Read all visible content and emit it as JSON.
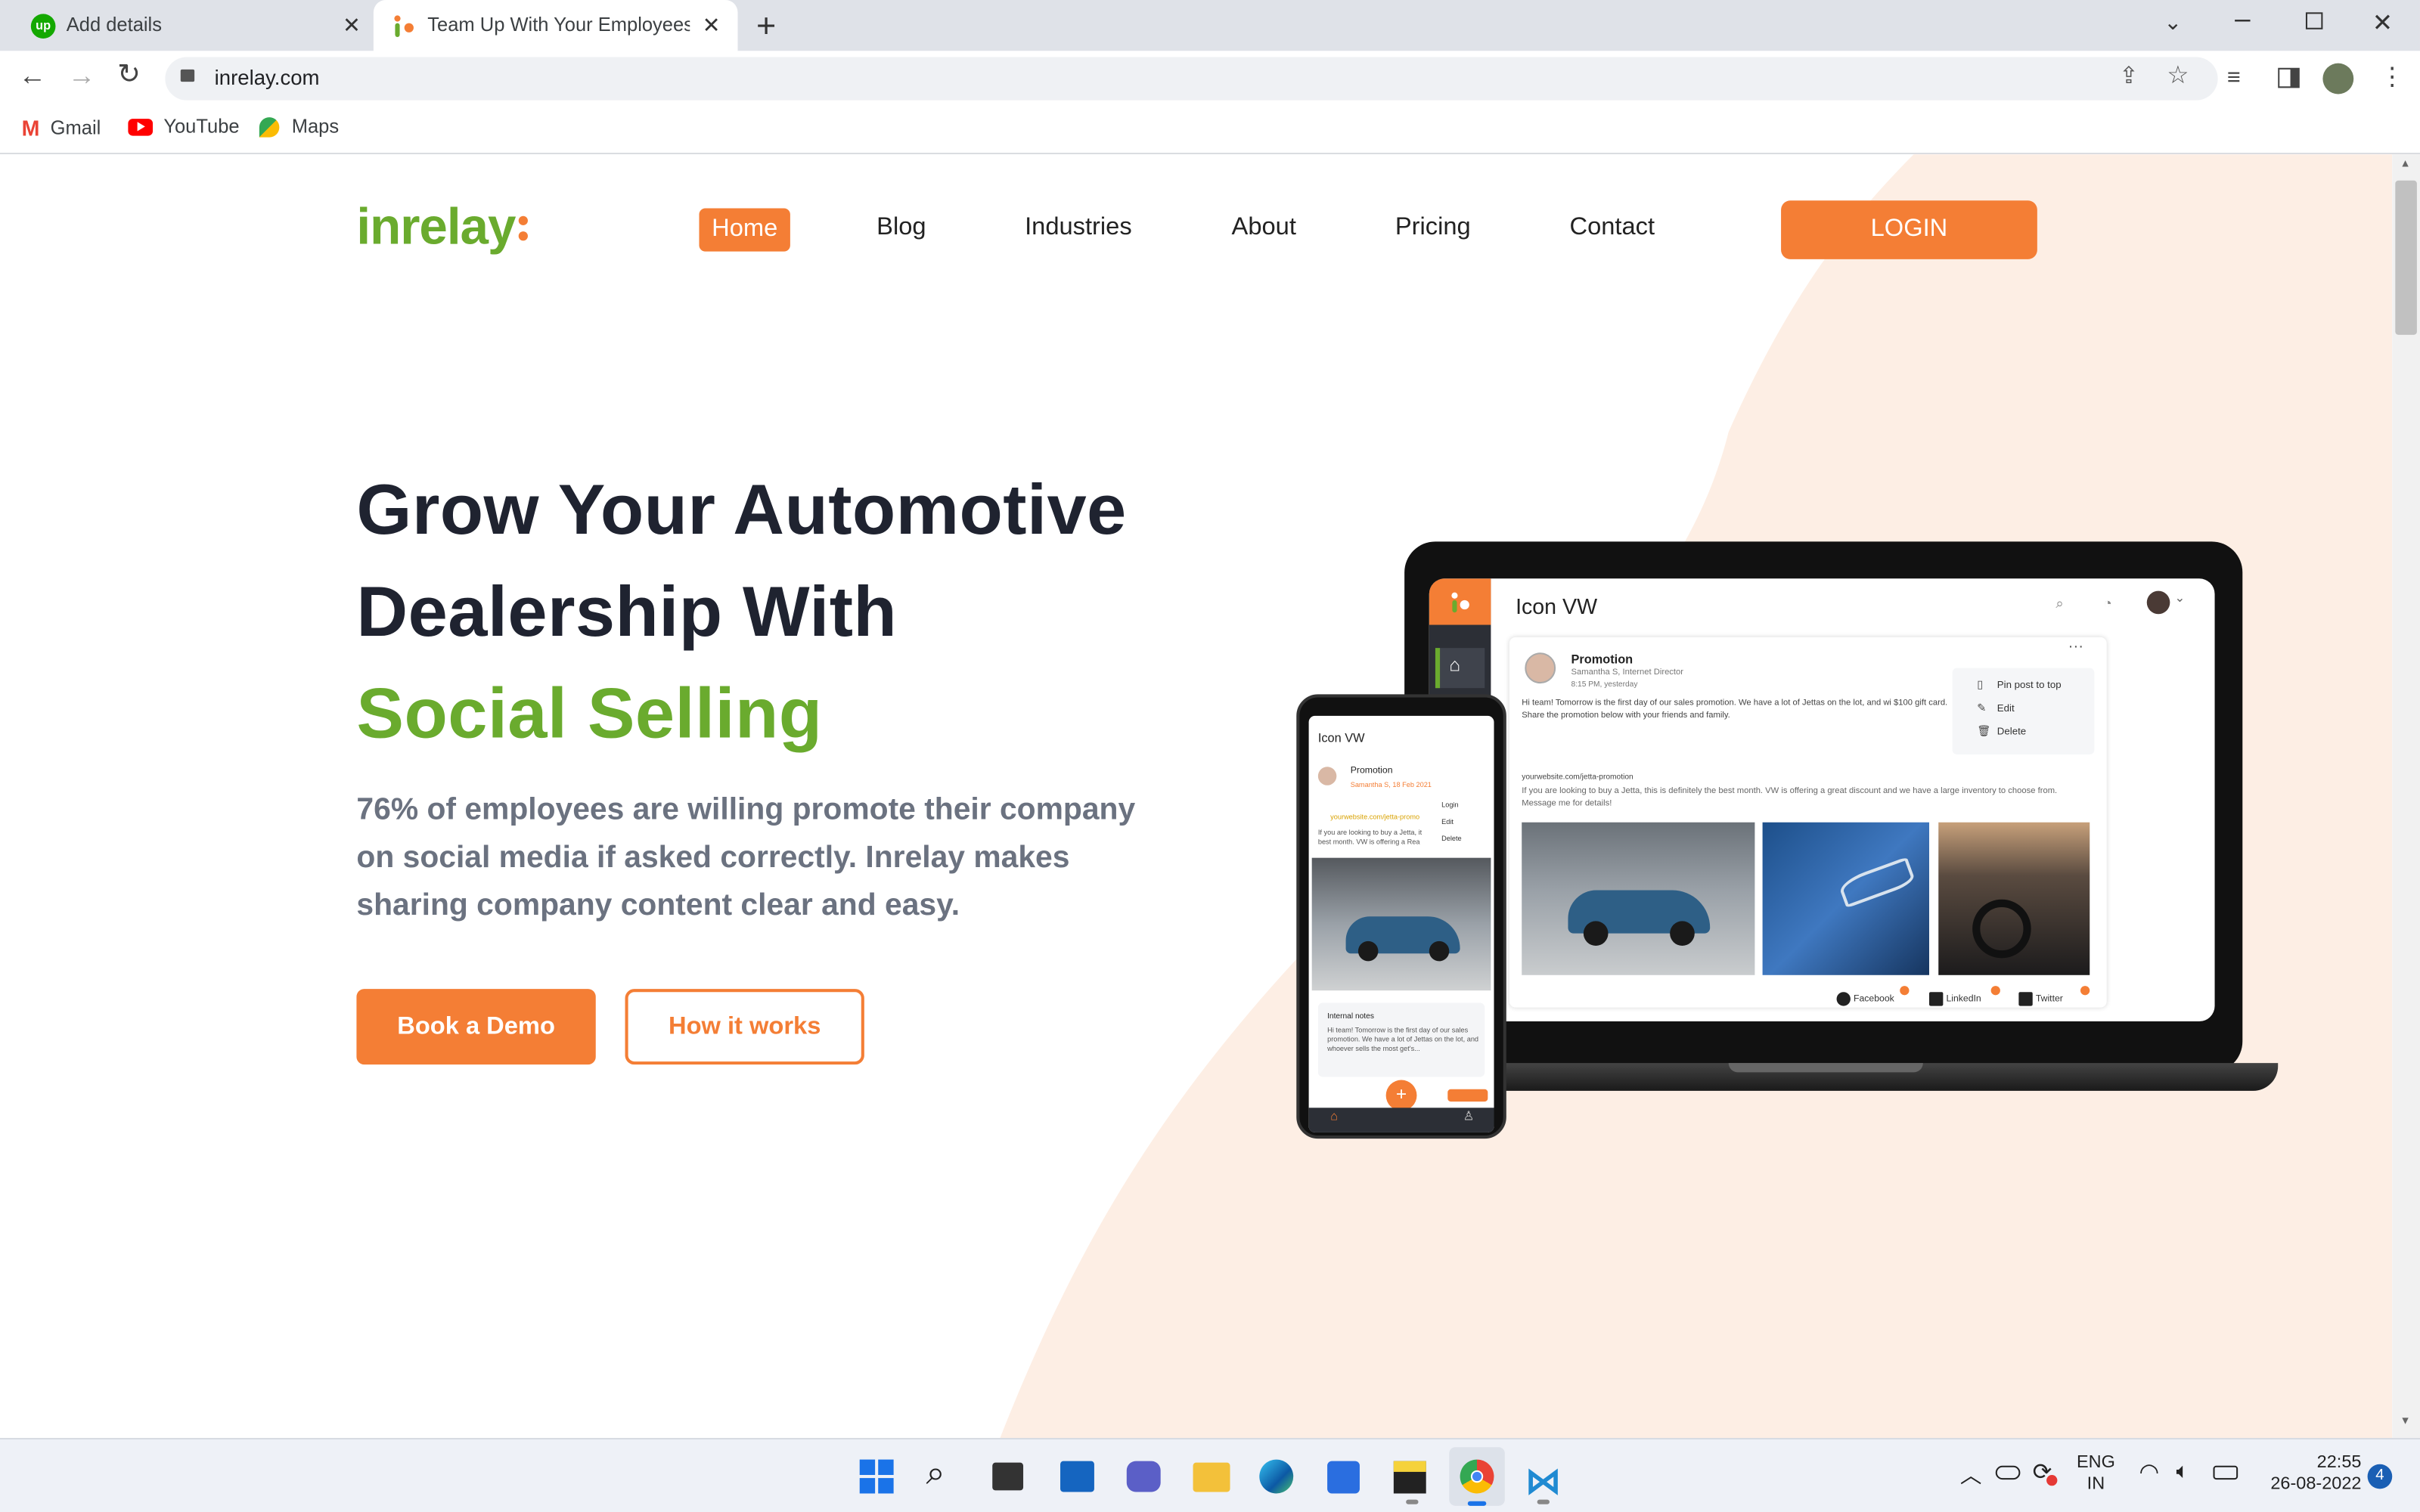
{
  "browser": {
    "tabs": [
      {
        "title": "Add details"
      },
      {
        "title": "Team Up With Your Employees a"
      }
    ],
    "address": "inrelay.com",
    "bookmarks": [
      "Gmail",
      "YouTube",
      "Maps"
    ]
  },
  "site": {
    "logo_text": "inrelay",
    "nav": [
      "Home",
      "Blog",
      "Industries",
      "About",
      "Pricing",
      "Contact"
    ],
    "login_label": "LOGIN",
    "hero": {
      "line1": "Grow Your Automotive",
      "line2": "Dealership With",
      "line3": "Social Selling",
      "subtitle": "76% of employees are willing promote their company on social media if asked correctly. Inrelay makes sharing company content clear and easy.",
      "primary_cta": "Book a Demo",
      "secondary_cta": "How it works"
    },
    "laptop_mock": {
      "app_title": "Icon VW",
      "post_title": "Promotion",
      "post_author": "Samantha S, Internet Director",
      "post_time": "8:15 PM, yesterday",
      "post_text": "Hi team! Tomorrow is the first day of our sales promotion. We have a lot of Jettas on the lot, and wi $100 gift card. Share the promotion below with your friends and family.",
      "menu": [
        "Pin post to top",
        "Edit",
        "Delete"
      ],
      "link": "yourwebsite.com/jetta-promotion",
      "link_text": "If you are looking to buy a Jetta, this is definitely the best month. VW is offering a great discount and we have a large inventory to choose from. Message me for details!",
      "socials": [
        "Facebook",
        "LinkedIn",
        "Twitter"
      ]
    },
    "phone_mock": {
      "app_title": "Icon VW",
      "post_title": "Promotion",
      "post_author": "Samantha S, 18 Feb 2021",
      "link": "yourwebsite.com/jetta-promo",
      "menu": [
        "Login",
        "Edit",
        "Delete"
      ],
      "link_text": "If you are looking to buy a Jetta, it best month. VW is offering a Rea",
      "notes_title": "Internal notes",
      "notes_text": "Hi team! Tomorrow is the first day of our sales promotion. We have a lot of Jettas on the lot, and whoever sells the most get's..."
    }
  },
  "taskbar": {
    "lang_top": "ENG",
    "lang_bottom": "IN",
    "time": "22:55",
    "date": "26-08-2022",
    "notifications": "4"
  },
  "colors": {
    "accent": "#f47e35",
    "green": "#6aab2e",
    "heading": "#1f2330",
    "peach": "#fdeee4"
  }
}
